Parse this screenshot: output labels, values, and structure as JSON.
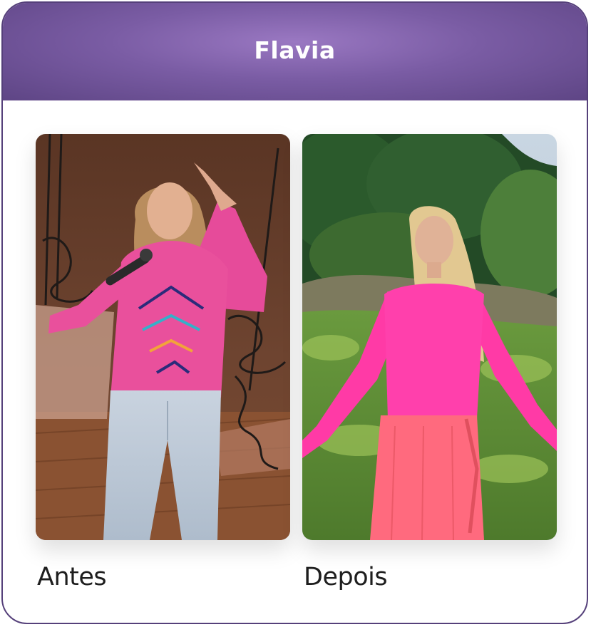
{
  "card": {
    "title": "Flavia"
  },
  "comparison": {
    "before_label": "Antes",
    "after_label": "Depois"
  },
  "colors": {
    "header_gradient_center": "#9a78c2",
    "header_gradient_edge": "#5e4585",
    "card_border": "#55407a",
    "caption_text": "#1e1e1e"
  }
}
